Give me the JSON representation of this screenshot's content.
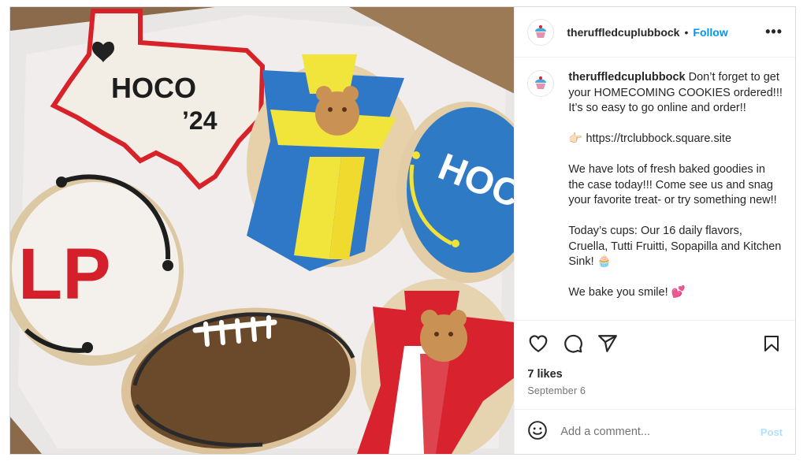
{
  "post": {
    "username": "theruffledcuplubbock",
    "header_dot": "•",
    "follow_label": "Follow",
    "more_label": "•••",
    "avatar_text": "theruffledcup",
    "caption_user": "theruffledcuplubbock",
    "caption_text": " Don’t forget to get your HOMECOMING COOKIES ordered!!! It’s so easy to go online and order!!\n\n👉🏻 https://trclubbock.square.site\n\nWe have lots of fresh baked goodies in the case today!!! Come see us and snag your favorite treat- or try something new!!\n\nToday’s cups: Our 16 daily flavors, Cruella, Tutti Fruitti, Sopapilla and Kitchen Sink! 🧁\n\nWe bake you smile! 💕",
    "likes": "7 likes",
    "date": "September 6",
    "comment_placeholder": "Add a comment...",
    "post_button": "Post"
  },
  "photo": {
    "cookie_texas_text_1": "HOCO",
    "cookie_texas_text_2": "’24",
    "cookie_blue_text": "HOCO",
    "cookie_logo_text": "LP"
  },
  "icons": {
    "like": "heart-icon",
    "comment": "comment-icon",
    "share": "share-icon",
    "save": "bookmark-icon",
    "emoji": "emoji-icon"
  },
  "colors": {
    "accent": "#0095f6",
    "post_disabled": "#b2dffc",
    "secondary_text": "#737373"
  }
}
